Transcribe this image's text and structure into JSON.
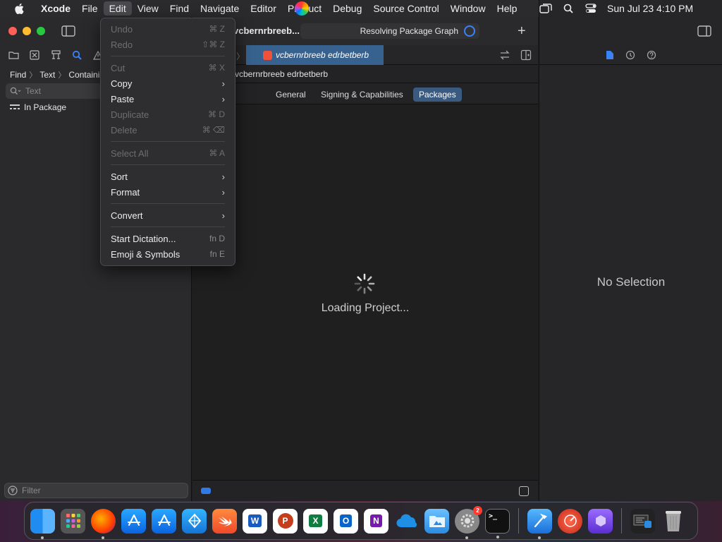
{
  "menubar": {
    "app": "Xcode",
    "items": [
      "File",
      "Edit",
      "View",
      "Find",
      "Navigate",
      "Editor",
      "Product",
      "Debug",
      "Source Control",
      "Window",
      "Help"
    ],
    "active": "Edit",
    "clock": "Sun Jul 23  4:10 PM"
  },
  "navigator": {
    "breadcrumb": [
      "Find",
      "Text",
      "Containing"
    ],
    "search_placeholder": "Text",
    "scope": "In Package",
    "filter_placeholder": "Filter"
  },
  "editor": {
    "project_title": "vcbernrbreeb...",
    "status": "Resolving Package Graph",
    "tab_label": "vcbernrbreeb edrbetberb",
    "jump_path": "vcbernrbreeb edrbetberb",
    "segments": [
      "General",
      "Signing & Capabilities",
      "Packages"
    ],
    "active_segment": "Packages",
    "loading_text": "Loading Project..."
  },
  "inspector": {
    "empty_text": "No Selection"
  },
  "edit_menu": {
    "undo": {
      "label": "Undo",
      "shortcut": "⌘ Z"
    },
    "redo": {
      "label": "Redo",
      "shortcut": "⇧⌘ Z"
    },
    "cut": {
      "label": "Cut",
      "shortcut": "⌘ X"
    },
    "copy": {
      "label": "Copy"
    },
    "paste": {
      "label": "Paste"
    },
    "duplicate": {
      "label": "Duplicate",
      "shortcut": "⌘ D"
    },
    "delete": {
      "label": "Delete",
      "shortcut": "⌘ ⌫"
    },
    "select_all": {
      "label": "Select All",
      "shortcut": "⌘ A"
    },
    "sort": {
      "label": "Sort"
    },
    "format": {
      "label": "Format"
    },
    "convert": {
      "label": "Convert"
    },
    "dictation": {
      "label": "Start Dictation...",
      "shortcut": "fn D"
    },
    "emoji": {
      "label": "Emoji & Symbols",
      "shortcut": "fn E"
    }
  },
  "dock": {
    "settings_badge": "2",
    "terminal_glyph": ">_"
  },
  "colors": {
    "accent": "#3b82f6",
    "tab_active": "#37628f",
    "segment_active": "#3b5a80",
    "menu_bg": "#2e2e30"
  }
}
